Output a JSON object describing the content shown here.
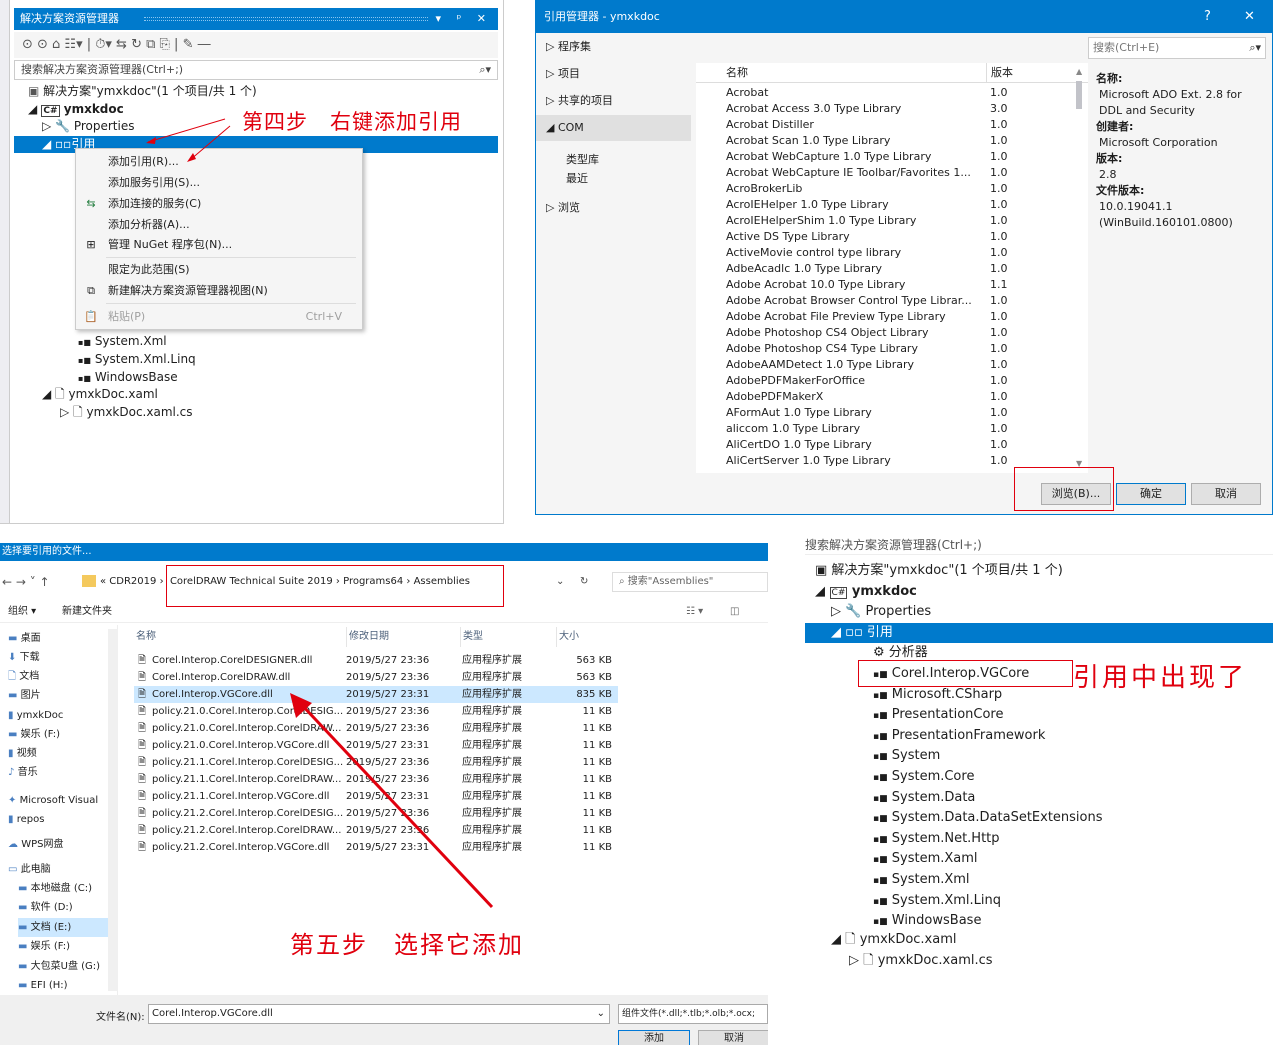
{
  "p1": {
    "title": "解决方案资源管理器",
    "title_icons": "▾ ᵖ ✕",
    "toolbar": "⊙ ⊙ ⌂ ☷▾ | ⏱▾ ⇆ ↻ ⧉ ⎘ | ✎ ―",
    "search_placeholder": "搜索解决方案资源管理器(Ctrl+;)",
    "tree": {
      "solution": "解决方案\"ymxkdoc\"(1 个项目/共 1 个)",
      "project": "ymxkdoc",
      "properties": "Properties",
      "references": "引用",
      "sys_xml": "System.Xml",
      "sys_xml_linq": "System.Xml.Linq",
      "windowsbase": "WindowsBase",
      "xaml": "ymxkDoc.xaml",
      "xaml_cs": "ymxkDoc.xaml.cs"
    },
    "ctx": {
      "add_ref": "添加引用(R)...",
      "add_svc": "添加服务引用(S)...",
      "add_conn": "添加连接的服务(C)",
      "add_analyzer": "添加分析器(A)...",
      "nuget": "管理 NuGet 程序包(N)...",
      "scope": "限定为此范围(S)",
      "new_view": "新建解决方案资源管理器视图(N)",
      "paste": "粘贴(P)",
      "paste_key": "Ctrl+V"
    },
    "annotation": "第四步　右键添加引用"
  },
  "p2": {
    "title": "引用管理器 - ymxkdoc",
    "help": "?",
    "close": "✕",
    "search": "搜索(Ctrl+E)",
    "nav": {
      "assemblies": "程序集",
      "projects": "项目",
      "shared": "共享的项目",
      "com": "COM",
      "typelib": "类型库",
      "recent": "最近",
      "browse": "浏览"
    },
    "col_name": "名称",
    "col_ver": "版本",
    "rows": [
      [
        "Acrobat",
        "1.0"
      ],
      [
        "Acrobat Access 3.0 Type Library",
        "3.0"
      ],
      [
        "Acrobat Distiller",
        "1.0"
      ],
      [
        "Acrobat Scan 1.0 Type Library",
        "1.0"
      ],
      [
        "Acrobat WebCapture 1.0 Type Library",
        "1.0"
      ],
      [
        "Acrobat WebCapture IE Toolbar/Favorites 1...",
        "1.0"
      ],
      [
        "AcroBrokerLib",
        "1.0"
      ],
      [
        "AcroIEHelper 1.0 Type Library",
        "1.0"
      ],
      [
        "AcroIEHelperShim 1.0 Type Library",
        "1.0"
      ],
      [
        "Active DS Type Library",
        "1.0"
      ],
      [
        "ActiveMovie control type library",
        "1.0"
      ],
      [
        "AdbeAcadlc 1.0 Type Library",
        "1.0"
      ],
      [
        "Adobe Acrobat 10.0 Type Library",
        "1.1"
      ],
      [
        "Adobe Acrobat Browser Control Type Librar...",
        "1.0"
      ],
      [
        "Adobe Acrobat File Preview Type Library",
        "1.0"
      ],
      [
        "Adobe Photoshop CS4 Object Library",
        "1.0"
      ],
      [
        "Adobe Photoshop CS4 Type Library",
        "1.0"
      ],
      [
        "AdobeAAMDetect 1.0 Type Library",
        "1.0"
      ],
      [
        "AdobePDFMakerForOffice",
        "1.0"
      ],
      [
        "AdobePDFMakerX",
        "1.0"
      ],
      [
        "AFormAut 1.0 Type Library",
        "1.0"
      ],
      [
        "aliccom 1.0 Type Library",
        "1.0"
      ],
      [
        "AliCertDO 1.0 Type Library",
        "1.0"
      ],
      [
        "AliCertServer 1.0 Type Library",
        "1.0"
      ]
    ],
    "details": {
      "name_label": "名称:",
      "name_value": "Microsoft ADO Ext. 2.8 for DDL and Security",
      "creator_label": "创建者:",
      "creator_value": "Microsoft Corporation",
      "version_label": "版本:",
      "version_value": "2.8",
      "filever_label": "文件版本:",
      "filever_value": "10.0.19041.1 (WinBuild.160101.0800)"
    },
    "btn_browse": "浏览(B)...",
    "btn_ok": "确定",
    "btn_cancel": "取消"
  },
  "p3": {
    "title": "选择要引用的文件...",
    "nav_arrows": "← → ˅ ↑",
    "path": [
      "CDR2019",
      "CorelDRAW Technical Suite 2019",
      "Programs64",
      "Assemblies"
    ],
    "search": "搜索\"Assemblies\"",
    "organize": "组织 ▾",
    "new_folder": "新建文件夹",
    "cols": {
      "name": "名称",
      "date": "修改日期",
      "type": "类型",
      "size": "大小"
    },
    "files": [
      [
        "Corel.Interop.CorelDESIGNER.dll",
        "2019/5/27 23:36",
        "应用程序扩展",
        "563 KB"
      ],
      [
        "Corel.Interop.CorelDRAW.dll",
        "2019/5/27 23:36",
        "应用程序扩展",
        "563 KB"
      ],
      [
        "Corel.Interop.VGCore.dll",
        "2019/5/27 23:31",
        "应用程序扩展",
        "835 KB"
      ],
      [
        "policy.21.0.Corel.Interop.CorelDESIG...",
        "2019/5/27 23:36",
        "应用程序扩展",
        "11 KB"
      ],
      [
        "policy.21.0.Corel.Interop.CorelDRAW...",
        "2019/5/27 23:36",
        "应用程序扩展",
        "11 KB"
      ],
      [
        "policy.21.0.Corel.Interop.VGCore.dll",
        "2019/5/27 23:31",
        "应用程序扩展",
        "11 KB"
      ],
      [
        "policy.21.1.Corel.Interop.CorelDESIG...",
        "2019/5/27 23:36",
        "应用程序扩展",
        "11 KB"
      ],
      [
        "policy.21.1.Corel.Interop.CorelDRAW...",
        "2019/5/27 23:36",
        "应用程序扩展",
        "11 KB"
      ],
      [
        "policy.21.1.Corel.Interop.VGCore.dll",
        "2019/5/27 23:31",
        "应用程序扩展",
        "11 KB"
      ],
      [
        "policy.21.2.Corel.Interop.CorelDESIG...",
        "2019/5/27 23:36",
        "应用程序扩展",
        "11 KB"
      ],
      [
        "policy.21.2.Corel.Interop.CorelDRAW...",
        "2019/5/27 23:36",
        "应用程序扩展",
        "11 KB"
      ],
      [
        "policy.21.2.Corel.Interop.VGCore.dll",
        "2019/5/27 23:31",
        "应用程序扩展",
        "11 KB"
      ]
    ],
    "sidebar": [
      "桌面",
      "下载",
      "文档",
      "图片",
      "ymxkDoc",
      "娱乐 (F:)",
      "视频",
      "音乐",
      "Microsoft Visual",
      "repos",
      "WPS网盘",
      "此电脑",
      "本地磁盘 (C:)",
      "软件 (D:)",
      "文档 (E:)",
      "娱乐 (F:)",
      "大包菜U盘 (G:)",
      "EFI (H:)"
    ],
    "filename_label": "文件名(N):",
    "filename_value": "Corel.Interop.VGCore.dll",
    "filter": "组件文件(*.dll;*.tlb;*.olb;*.ocx;",
    "btn_add": "添加",
    "btn_cancel": "取消",
    "annotation": "第五步　选择它添加"
  },
  "p4": {
    "search": "搜索解决方案资源管理器(Ctrl+;)",
    "solution": "解决方案\"ymxkdoc\"(1 个项目/共 1 个)",
    "project": "ymxkdoc",
    "properties": "Properties",
    "references": "引用",
    "analyzer": "分析器",
    "refs": [
      "Corel.Interop.VGCore",
      "Microsoft.CSharp",
      "PresentationCore",
      "PresentationFramework",
      "System",
      "System.Core",
      "System.Data",
      "System.Data.DataSetExtensions",
      "System.Net.Http",
      "System.Xaml",
      "System.Xml",
      "System.Xml.Linq",
      "WindowsBase"
    ],
    "xaml": "ymxkDoc.xaml",
    "xaml_cs": "ymxkDoc.xaml.cs",
    "annotation": "引用中出现了"
  }
}
